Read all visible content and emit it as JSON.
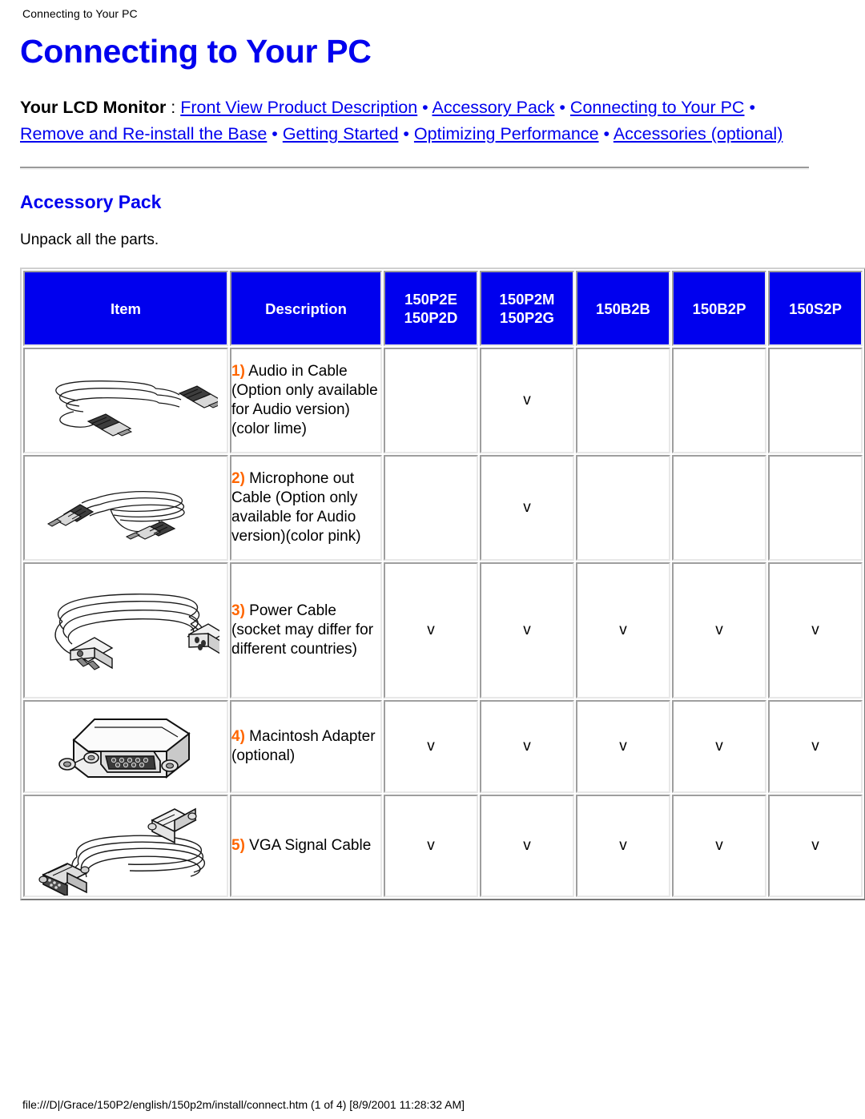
{
  "running_header": "Connecting to Your PC",
  "page_title": "Connecting to Your PC",
  "nav": {
    "lead_label": "Your LCD Monitor",
    "colon": " : ",
    "separator": " • ",
    "links": [
      "Front View Product Description",
      "Accessory Pack",
      "Connecting to Your PC",
      "Remove and Re-install the Base",
      "Getting Started",
      "Optimizing Performance",
      "Accessories (optional)"
    ]
  },
  "section": {
    "title": "Accessory Pack",
    "intro": "Unpack all the parts."
  },
  "table": {
    "headers": {
      "item": "Item",
      "description": "Description",
      "c1_line1": "150P2E",
      "c1_line2": "150P2D",
      "c2_line1": "150P2M",
      "c2_line2": "150P2G",
      "c3": "150B2B",
      "c4": "150B2P",
      "c5": "150S2P"
    },
    "check_mark": "v",
    "rows": [
      {
        "num": "1)",
        "desc": " Audio in Cable (Option only available for Audio version)(color lime)",
        "icon": "audio-in-cable-image",
        "checks": [
          "",
          "v",
          "",
          "",
          ""
        ]
      },
      {
        "num": "2)",
        "desc": " Microphone out Cable (Option only available for Audio version)(color pink)",
        "icon": "microphone-out-cable-image",
        "checks": [
          "",
          "v",
          "",
          "",
          ""
        ]
      },
      {
        "num": "3)",
        "desc": " Power Cable (socket may differ for different countries)",
        "icon": "power-cable-image",
        "checks": [
          "v",
          "v",
          "v",
          "v",
          "v"
        ]
      },
      {
        "num": "4)",
        "desc": " Macintosh Adapter (optional)",
        "icon": "macintosh-adapter-image",
        "checks": [
          "v",
          "v",
          "v",
          "v",
          "v"
        ]
      },
      {
        "num": "5)",
        "desc": " VGA Signal Cable",
        "icon": "vga-signal-cable-image",
        "checks": [
          "v",
          "v",
          "v",
          "v",
          "v"
        ]
      }
    ]
  },
  "footer_path": "file:///D|/Grace/150P2/english/150p2m/install/connect.htm (1 of 4) [8/9/2001 11:28:32 AM]",
  "colors": {
    "link_blue": "#0000EE",
    "header_blue": "#0000EE",
    "number_orange": "#FF6600",
    "text_black": "#000000"
  }
}
